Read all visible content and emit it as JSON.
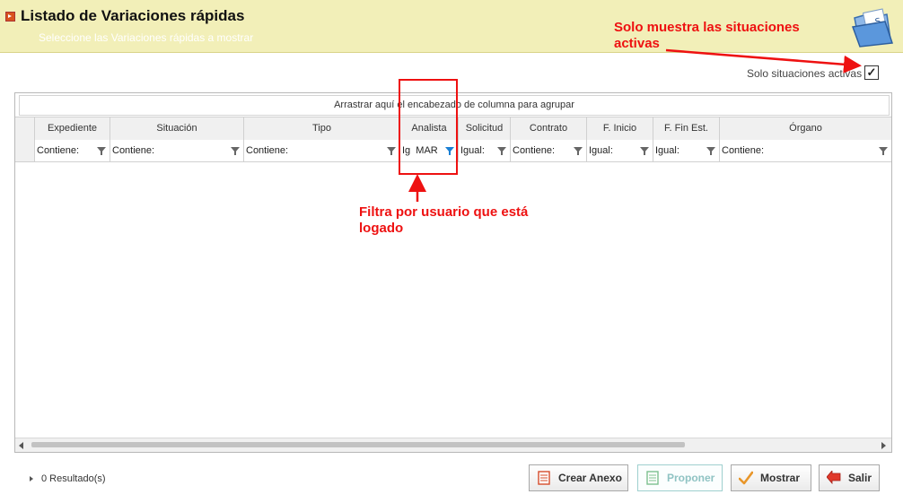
{
  "header": {
    "title": "Listado de Variaciones rápidas",
    "subtitle": "Seleccione las Variaciones rápidas a mostrar"
  },
  "annotations": {
    "top_line1": "Solo muestra las situaciones",
    "top_line2": "activas",
    "mid_line1": "Filtra por usuario que está",
    "mid_line2": "logado"
  },
  "filter_option": {
    "label": "Solo situaciones activas",
    "checked": true,
    "check_glyph": "✓"
  },
  "grid": {
    "group_bar": "Arrastrar aquí el encabezado de columna para agrupar",
    "columns": [
      {
        "header": "Expediente",
        "filter": "Contiene:"
      },
      {
        "header": "Situación",
        "filter": "Contiene:"
      },
      {
        "header": "Tipo",
        "filter": "Contiene:"
      },
      {
        "header": "Analista",
        "filter": "Ig  MAR",
        "filter_active": true
      },
      {
        "header": "Solicitud",
        "filter": "Igual:"
      },
      {
        "header": "Contrato",
        "filter": "Contiene:"
      },
      {
        "header": "F. Inicio",
        "filter": "Igual:"
      },
      {
        "header": "F. Fin Est.",
        "filter": "Igual:"
      },
      {
        "header": "Órgano",
        "filter": "Contiene:"
      }
    ]
  },
  "footer": {
    "results": "0 Resultado(s)",
    "buttons": {
      "crear": "Crear Anexo",
      "proponer": "Proponer",
      "mostrar": "Mostrar",
      "salir": "Salir"
    }
  },
  "colors": {
    "header_bg": "#f2efb8",
    "annotation": "#ee1111",
    "filter_active": "#1a7fd4"
  }
}
